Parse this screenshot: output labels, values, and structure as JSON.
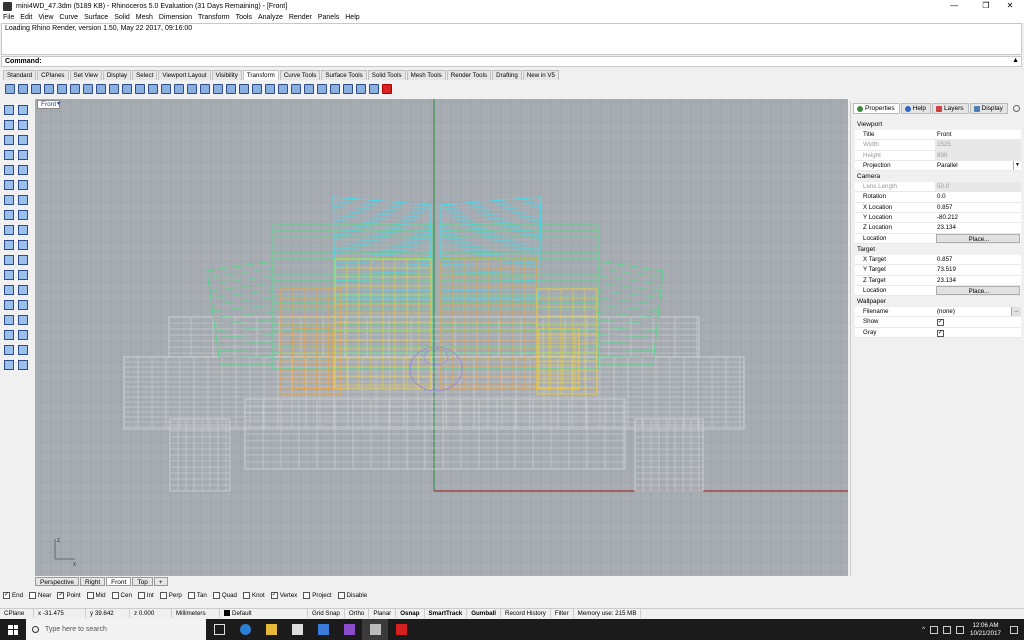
{
  "window": {
    "title": "mini4WD_47.3dm (5189 KB) - Rhinoceros 5.0 Evaluation (31 Days Remaining) - [Front]",
    "minimize": "—",
    "maximize": "❐",
    "close": "✕"
  },
  "menu": [
    "File",
    "Edit",
    "View",
    "Curve",
    "Surface",
    "Solid",
    "Mesh",
    "Dimension",
    "Transform",
    "Tools",
    "Analyze",
    "Render",
    "Panels",
    "Help"
  ],
  "command_history": "Loading Rhino Render, version 1.50, May 22 2017, 09:16:00",
  "command_prompt": "Command:",
  "toolbar_tabs": [
    "Standard",
    "CPlanes",
    "Set View",
    "Display",
    "Select",
    "Viewport Layout",
    "Visibility",
    "Transform",
    "Curve Tools",
    "Surface Tools",
    "Solid Tools",
    "Mesh Tools",
    "Render Tools",
    "Drafting",
    "New in V5"
  ],
  "active_toolbar_tab": "Transform",
  "viewport": {
    "label": "Front",
    "tabs": [
      "Perspective",
      "Right",
      "Front",
      "Top"
    ],
    "active_tab": "Front",
    "add_tab": "+",
    "axis_z": "z",
    "axis_x": "x"
  },
  "panel": {
    "tabs": [
      "Properties",
      "Help",
      "Layers",
      "Display"
    ],
    "active_tab": "Properties",
    "sections": {
      "viewport": "Viewport",
      "camera": "Camera",
      "target": "Target",
      "wallpaper": "Wallpaper"
    },
    "viewport_rows": {
      "title_k": "Title",
      "title_v": "Front",
      "width_k": "Width",
      "width_v": "1525",
      "height_k": "Height",
      "height_v": "890",
      "projection_k": "Projection",
      "projection_v": "Parallel"
    },
    "camera_rows": {
      "lens_k": "Lens Length",
      "lens_v": "50.0",
      "rotation_k": "Rotation",
      "rotation_v": "0.0",
      "xloc_k": "X Location",
      "xloc_v": "0.857",
      "yloc_k": "Y Location",
      "yloc_v": "-80.212",
      "zloc_k": "Z Location",
      "zloc_v": "23.134",
      "loc_k": "Location",
      "loc_btn": "Place..."
    },
    "target_rows": {
      "xt_k": "X Target",
      "xt_v": "0.857",
      "yt_k": "Y Target",
      "yt_v": "73.519",
      "zt_k": "Z Target",
      "zt_v": "23.134",
      "loc_k": "Location",
      "loc_btn": "Place..."
    },
    "wallpaper_rows": {
      "file_k": "Filename",
      "file_v": "(none)",
      "file_btn": "...",
      "show_k": "Show",
      "show_v": true,
      "gray_k": "Gray",
      "gray_v": true
    }
  },
  "osnaps": [
    {
      "label": "End",
      "checked": true
    },
    {
      "label": "Near",
      "checked": false
    },
    {
      "label": "Point",
      "checked": true
    },
    {
      "label": "Mid",
      "checked": false
    },
    {
      "label": "Cen",
      "checked": false
    },
    {
      "label": "Int",
      "checked": false
    },
    {
      "label": "Perp",
      "checked": false
    },
    {
      "label": "Tan",
      "checked": false
    },
    {
      "label": "Quad",
      "checked": false
    },
    {
      "label": "Knot",
      "checked": false
    },
    {
      "label": "Vertex",
      "checked": true
    },
    {
      "label": "Project",
      "checked": false
    },
    {
      "label": "Disable",
      "checked": false
    }
  ],
  "status": {
    "cplane": "CPlane",
    "x": "x -31.475",
    "y": "y 39.642",
    "z": "z 0.000",
    "units": "Millimeters",
    "layer": "Default",
    "grid_snap": "Grid Snap",
    "ortho": "Ortho",
    "planar": "Planar",
    "osnap": "Osnap",
    "smarttrack": "SmartTrack",
    "gumball": "Gumball",
    "record_history": "Record History",
    "filter": "Filter",
    "memory": "Memory use: 215 MB"
  },
  "taskbar": {
    "search_placeholder": "Type here to search",
    "time": "12:06 AM",
    "date": "10/21/2017"
  },
  "colors": {
    "viewport_bg": "#a7adb3",
    "grid_line": "#9aa0a6",
    "axis_green": "#1f8a3a",
    "axis_red": "#a01818",
    "wire_gray": "#d8d8d8",
    "wire_cyan": "#3ee0f0",
    "wire_green": "#55d88a",
    "wire_yellow": "#ffd21a",
    "wire_orange": "#ffa020",
    "wire_purple": "#9c8cd8"
  }
}
